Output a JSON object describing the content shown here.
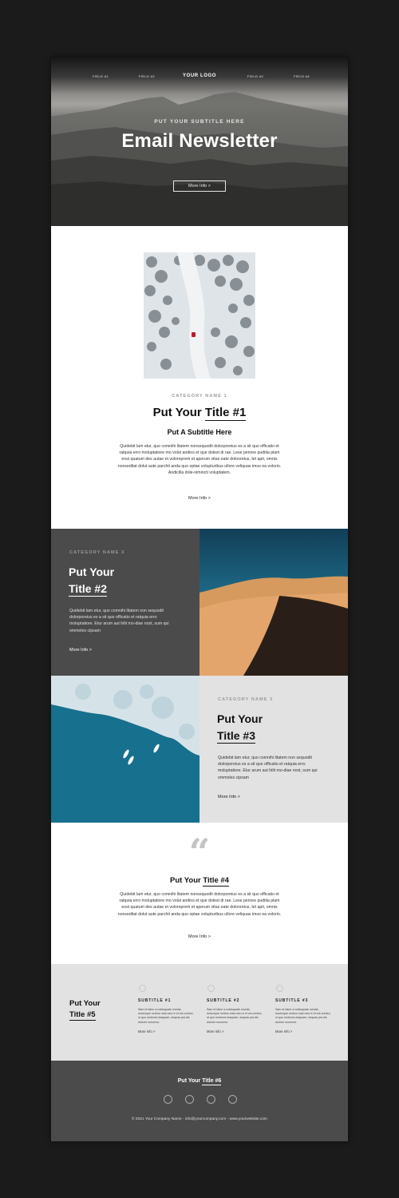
{
  "header": {
    "nav_left": [
      "FIELD #1",
      "FIELD #2"
    ],
    "logo": "YOUR LOGO",
    "nav_right": [
      "FIELD #3",
      "FIELD #4"
    ],
    "subtitle": "PUT YOUR SUBTITLE HERE",
    "title": "Email Newsletter",
    "button_label": "More Info >"
  },
  "section1": {
    "image": "snowy-forest-road-photo",
    "category": "CATEGORY NAME 1",
    "title_plain": "Put Your ",
    "title_underlined": "Title #1",
    "subtitle": "Put A Subtitle Here",
    "body": "Quidebit lam etur, quo comnihi litatem nonsequodit dolorporeius es a sit quo officatio et ratquia erro moluptatiore mo volut andios et que dolest di rae. Lese periore puditia plam eost quatum des autae et voloreprem et aperum vitas eate dolorentus, tet apit, omnis nonseditat dolut aute parchit anda quo optae volupturibus ullore veliquas imus ea volorio. Andicilla dole-nimincti voluptatem.",
    "more": "More Info >"
  },
  "section2": {
    "image": "desert-dune-photo",
    "category": "CATEGORY NAME 3",
    "title_line1": "Put Your",
    "title_line2": "Title #2",
    "body": "Quidebit lam etur, quo comnihi litatem non sequodit dolorporeius es a sit quo officatio et ratquia erro moluptatiore. Etur arum aut hilit mo-diae nost, sum qui ommoles cipsam",
    "more": "More Info >"
  },
  "section3": {
    "image": "ocean-surfers-aerial-photo",
    "category": "CATEGORY NAME 3",
    "title_line1": "Put Your",
    "title_line2": "Title #3",
    "body": "Quidebit lam etur, quo comnihi litatem non sequodit dolorporeius es a sit quo officatio et ratquia erro moluptatiore. Etur arum aut hilit mo-diae nost, sum qui ommoles cipsam",
    "more": "More Info >"
  },
  "section4": {
    "quote_glyph": "“",
    "title_plain": "Put Your ",
    "title_underlined": "Title #4",
    "body": "Quidebit lam etur, quo comnihi litatem nonsequodit dolorporeius es a sit quo officatio et ratquia erro moluptatiore mo volut andios et que dolest di rae. Lese periore puditia plam eost quatum des autae et voloreprem et aperum vitas eate dolorentus, tet apit, omnis nonseditat dolut aute parchit anda quo optae volupturibus ullore veliquas imus ea volorio.",
    "more": "More Info >"
  },
  "section5": {
    "title_line1": "Put Your",
    "title_line2": "Title #5",
    "columns": [
      {
        "subtitle": "SUBTITLE #1",
        "body": "Sam et labor a nobisquate omnist, eusenque norbus mas nea re et vol-orectur, ut quo moleces etaquam, sequas pra dis dolorer sonceror.",
        "more": "More Info >"
      },
      {
        "subtitle": "SUBTITLE #2",
        "body": "Sam et labor a nobisquate omnist, eusenque norbus mas nea re et vol-orectur, ut quo moleces etaquam, sequas pra dis dolorer sonceror.",
        "more": "More Info >"
      },
      {
        "subtitle": "SUBTITLE #3",
        "body": "Sam et labor a nobisquate omnist, eusenque norbus mas nea re et vol-orectur, ut quo moleces etaquam, sequas pra dis dolorer sonceror.",
        "more": "More Info >"
      }
    ]
  },
  "footer": {
    "title_plain": "Put Your ",
    "title_underlined": "Title #6",
    "social_icons": [
      "social-icon-1",
      "social-icon-2",
      "social-icon-3",
      "social-icon-4"
    ],
    "copyright": "© 2021 Your Company Name - info@yourcompany.com - www.yourwebsite.com"
  },
  "colors": {
    "backdrop": "#1b1b1b",
    "dark_panel": "#4b4b4b",
    "light_panel": "#e2e2e2",
    "category_gray": "#9a9a9a"
  }
}
